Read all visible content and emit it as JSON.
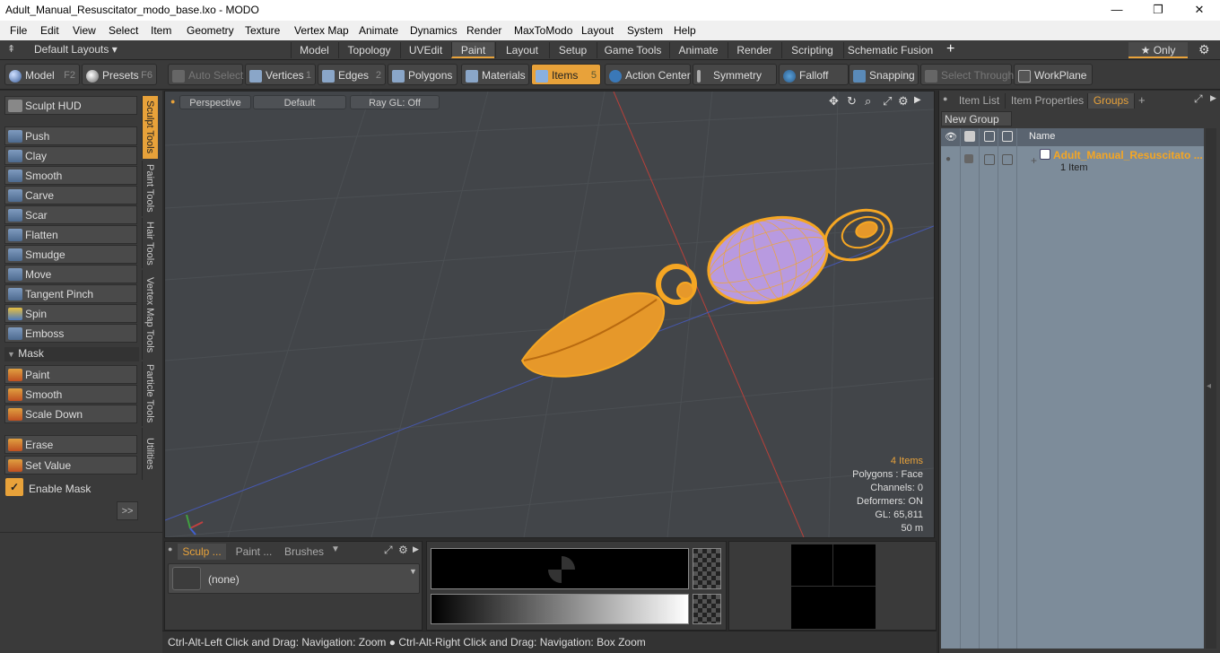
{
  "window": {
    "title": "Adult_Manual_Resuscitator_modo_base.lxo - MODO",
    "min": "—",
    "max": "❐",
    "close": "✕"
  },
  "menu": [
    "File",
    "Edit",
    "View",
    "Select",
    "Item",
    "Geometry",
    "Texture",
    "Vertex Map",
    "Animate",
    "Dynamics",
    "Render",
    "MaxToModo",
    "Layout",
    "System",
    "Help"
  ],
  "layoutbar": {
    "preset": "Default Layouts ▾",
    "tabs": [
      "Model",
      "Topology",
      "UVEdit",
      "Paint",
      "Layout",
      "Setup",
      "Game Tools",
      "Animate",
      "Render",
      "Scripting",
      "Schematic Fusion"
    ],
    "active_tab": "Paint",
    "add": "+",
    "only": "★  Only",
    "gear": "⚙"
  },
  "toolbar": {
    "model": "Model",
    "model_key": "F2",
    "presets": "Presets",
    "presets_key": "F6",
    "auto_select": "Auto Select",
    "vertices": "Vertices",
    "vertices_key": "1",
    "edges": "Edges",
    "edges_key": "2",
    "polygons": "Polygons",
    "materials": "Materials",
    "items": "Items",
    "items_key": "5",
    "action_center": "Action Center",
    "symmetry": "Symmetry",
    "falloff": "Falloff",
    "snapping": "Snapping",
    "select_through": "Select Through",
    "workplane": "WorkPlane"
  },
  "left": {
    "sculpt_hud": "Sculpt HUD",
    "tools": [
      "Push",
      "Clay",
      "Smooth",
      "Carve",
      "Scar",
      "Flatten",
      "Smudge",
      "Move",
      "Tangent Pinch",
      "Spin",
      "Emboss"
    ],
    "mask_header": "Mask",
    "mask_tools": [
      "Paint",
      "Smooth",
      "Scale Down"
    ],
    "erase": "Erase",
    "set_value": "Set Value",
    "enable_mask": "Enable Mask",
    "more": ">>",
    "vtabs": [
      "Sculpt Tools",
      "Paint Tools",
      "Hair Tools",
      "Vertex Map Tools",
      "Particle Tools",
      "Utilities"
    ]
  },
  "viewport": {
    "perspective": "Perspective",
    "shading": "Default",
    "raygl": "Ray GL: Off",
    "stats": [
      "4 Items",
      "Polygons : Face",
      "Channels: 0",
      "Deformers: ON",
      "GL: 65,811",
      "50 m"
    ],
    "accent": "#f5a623"
  },
  "bottom": {
    "tabs": [
      "Sculp ...",
      "Paint ...",
      "Brushes"
    ],
    "none": "(none)"
  },
  "status": "Ctrl-Alt-Left Click and Drag: Navigation: Zoom ● Ctrl-Alt-Right Click and Drag: Navigation: Box Zoom",
  "right": {
    "tabs": [
      "Item List",
      "Item Properties",
      "Groups"
    ],
    "active_tab": "Groups",
    "new_group": "New Group",
    "col_name": "Name",
    "group_name": "Adult_Manual_Resuscitato ...",
    "group_count": "1 Item"
  }
}
